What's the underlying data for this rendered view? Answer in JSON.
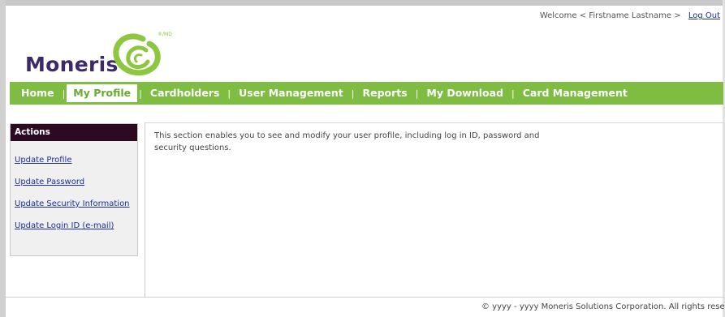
{
  "header": {
    "welcome_text": "Welcome < Firstname Lastname >",
    "logout_label": "Log Out"
  },
  "logo": {
    "name": "Moneris",
    "registered_mark": "®/MD"
  },
  "nav": {
    "items": [
      {
        "label": "Home"
      },
      {
        "label": "My Profile",
        "active": true
      },
      {
        "label": "Cardholders"
      },
      {
        "label": "User Management"
      },
      {
        "label": "Reports"
      },
      {
        "label": "My Download"
      },
      {
        "label": "Card Management"
      }
    ],
    "separator": "|"
  },
  "sidebar": {
    "header": "Actions",
    "links": [
      {
        "label": "Update Profile"
      },
      {
        "label": "Update Password"
      },
      {
        "label": "Update Security Information"
      },
      {
        "label": "Update Login ID (e-mail)"
      }
    ]
  },
  "main": {
    "description": "This section enables you to see and modify your user profile, including log in ID, password and security questions."
  },
  "footer": {
    "copyright": "©  yyyy - yyyy   Moneris Solutions Corporation. All rights reserved"
  },
  "colors": {
    "nav_bg": "#7ebd42",
    "sidebar_header_bg": "#2b0a22",
    "link": "#1a2e9e",
    "brand_purple": "#3b2a6b",
    "brand_green": "#8dc63f"
  }
}
